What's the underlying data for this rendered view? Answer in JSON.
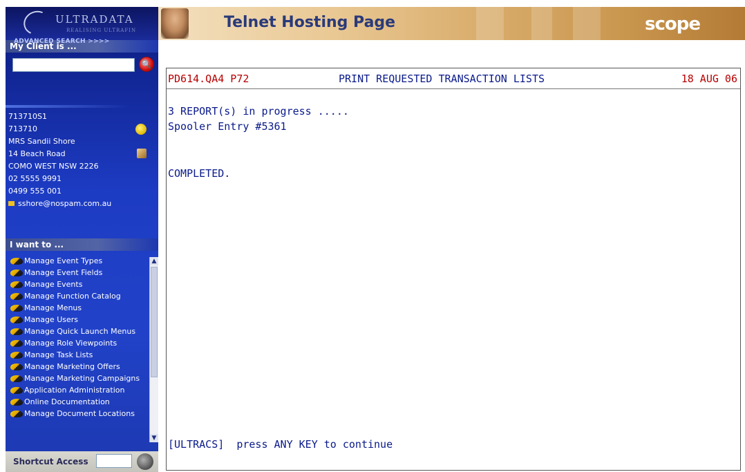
{
  "sidebar": {
    "logo": {
      "brand": "ULTRADATA",
      "tagline": "REALISING ULTRAFIN"
    },
    "client_section": {
      "title": "My Client is ...",
      "search_placeholder": "",
      "advanced_search": "ADVANCED SEARCH >>>>"
    },
    "client_info": {
      "account": "713710S1",
      "number": "713710",
      "name": "MRS Sandii Shore",
      "address1": "14 Beach Road",
      "address2": "COMO WEST NSW 2226",
      "phone": "02 5555 9991",
      "mobile": "0499 555 001",
      "email": "sshore@nospam.com.au"
    },
    "i_want_to": {
      "title": "I want to ...",
      "items": [
        {
          "label": "Manage Event Types"
        },
        {
          "label": "Manage Event Fields"
        },
        {
          "label": "Manage Events"
        },
        {
          "label": "Manage Function Catalog"
        },
        {
          "label": "Manage Menus"
        },
        {
          "label": "Manage Users"
        },
        {
          "label": "Manage Quick Launch Menus"
        },
        {
          "label": "Manage Role Viewpoints"
        },
        {
          "label": "Manage Task Lists"
        },
        {
          "label": "Manage Marketing Offers"
        },
        {
          "label": "Manage Marketing Campaigns"
        },
        {
          "label": "Application Administration"
        },
        {
          "label": "Online Documentation"
        },
        {
          "label": "Manage Document Locations"
        }
      ]
    },
    "shortcut": {
      "label": "Shortcut Access",
      "value": ""
    }
  },
  "header": {
    "title": "Telnet Hosting Page",
    "logo": "scope"
  },
  "terminal": {
    "code": "PD614.QA4 P72",
    "title": "PRINT REQUESTED TRANSACTION LISTS",
    "date": "18 AUG 06",
    "line1": "3 REPORT(s) in progress .....",
    "line2": "Spooler Entry #5361",
    "line3": "COMPLETED.",
    "footer": "[ULTRACS]  press ANY KEY to continue"
  },
  "colors": {
    "sidebar_blue": "#1d3cc4",
    "terminal_text": "#0a1a8a",
    "terminal_header_red": "#b80000",
    "header_gold": "#d9ad6d"
  }
}
